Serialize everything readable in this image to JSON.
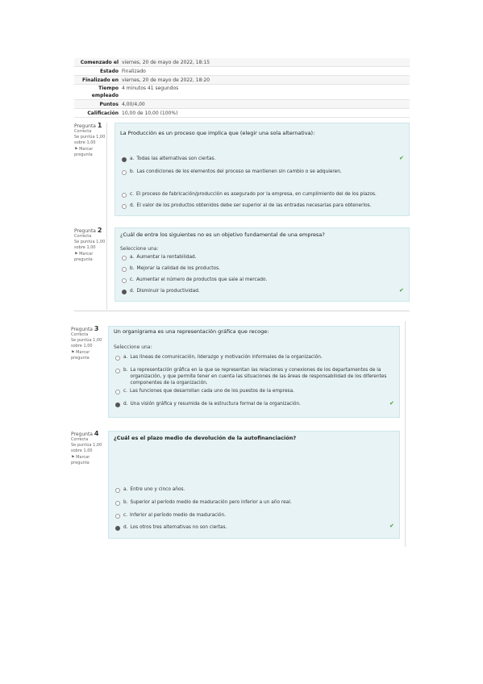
{
  "summary": [
    {
      "label": "Comenzado el",
      "value": "viernes, 20 de mayo de 2022, 18:15"
    },
    {
      "label": "Estado",
      "value": "Finalizado"
    },
    {
      "label": "Finalizado en",
      "value": "viernes, 20 de mayo de 2022, 18:20"
    },
    {
      "label": "Tiempo empleado",
      "value": "4 minutos 41 segundos"
    },
    {
      "label": "Puntos",
      "value": "4,00/4,00"
    },
    {
      "label": "Calificación",
      "value": "10,00 de 10,00 (100%)"
    }
  ],
  "questions": [
    {
      "no_label": "Pregunta",
      "no": "1",
      "status": "Correcta",
      "score": "Se puntúa 1,00 sobre 1,00",
      "flag": "Marcar pregunta",
      "text": "La Producción es un proceso que implica que (elegir una sola alternativa):",
      "prompt": "",
      "answers": [
        {
          "letter": "a.",
          "text": "Todas las alternativas son ciertas.",
          "selected": true
        },
        {
          "letter": "b.",
          "text": "Las condiciones de los elementos del proceso se mantienen sin cambio o se adquieren.",
          "selected": false
        },
        {
          "letter": "c.",
          "text": "El proceso de fabricación/producción es asegurado por la empresa, en cumplimiento del de los plazos.",
          "selected": false
        },
        {
          "letter": "d.",
          "text": "El valor de los productos obtenidos debe ser superior al de las entradas necesarias para obtenerlos.",
          "selected": false
        }
      ]
    },
    {
      "no_label": "Pregunta",
      "no": "2",
      "status": "Correcta",
      "score": "Se puntúa 1,00 sobre 1,00",
      "flag": "Marcar pregunta",
      "text": "¿Cuál de entre los siguientes no es un objetivo fundamental de una empresa?",
      "prompt": "Seleccione una:",
      "answers": [
        {
          "letter": "a.",
          "text": "Aumentar la rentabilidad.",
          "selected": false
        },
        {
          "letter": "b.",
          "text": "Mejorar la calidad de los productos.",
          "selected": false
        },
        {
          "letter": "c.",
          "text": "Aumentar el número de productos que sale al mercado.",
          "selected": false
        },
        {
          "letter": "d.",
          "text": "Disminuir la productividad.",
          "selected": true
        }
      ]
    },
    {
      "no_label": "Pregunta",
      "no": "3",
      "status": "Correcta",
      "score": "Se puntúa 1,00 sobre 1,00",
      "flag": "Marcar pregunta",
      "text": "Un organigrama es una representación gráfica que recoge:",
      "prompt": "Seleccione una:",
      "answers": [
        {
          "letter": "a.",
          "text": "Las líneas de comunicación, liderazgo y motivación informales de la organización.",
          "selected": false
        },
        {
          "letter": "b.",
          "text": "La representación gráfica en la que se representan las relaciones y conexiones de los departamentos de la organización, y que permite tener en cuenta las situaciones de las áreas de responsabilidad de los diferentes componentes de la organización.",
          "selected": false
        },
        {
          "letter": "c.",
          "text": "Las funciones que desarrollan cada uno de los puestos de la empresa.",
          "selected": false
        },
        {
          "letter": "d.",
          "text": "Una visión gráfica y resumida de la estructura formal de la organización.",
          "selected": true
        }
      ]
    },
    {
      "no_label": "Pregunta",
      "no": "4",
      "status": "Correcta",
      "score": "Se puntúa 1,00 sobre 1,00",
      "flag": "Marcar pregunta",
      "text": "¿Cuál es el plazo medio de devolución de la autofinanciación?",
      "prompt": "",
      "answers": [
        {
          "letter": "a.",
          "text": "Entre uno y cinco años.",
          "selected": false
        },
        {
          "letter": "b.",
          "text": "Superior al período medio de maduración pero inferior a un año real.",
          "selected": false
        },
        {
          "letter": "c.",
          "text": "Inferior al período medio de maduración.",
          "selected": false
        },
        {
          "letter": "d.",
          "text": "Los otros tres alternativas no son ciertas.",
          "selected": true
        }
      ]
    }
  ],
  "colors": {
    "correct_check": "#4a9a3e",
    "question_bg": "#e7f3f5"
  },
  "icons": {
    "check": "checkmark-icon",
    "flag": "flag-icon"
  }
}
